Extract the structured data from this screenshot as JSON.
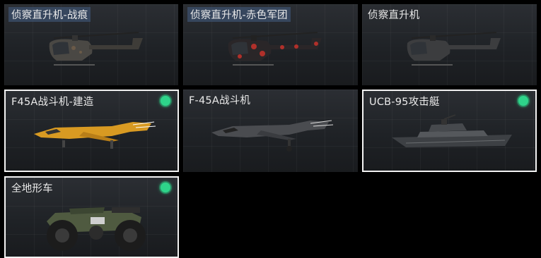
{
  "vehicles": [
    {
      "name": "侦察直升机-战痕"
    },
    {
      "name": "侦察直升机-赤色军团"
    },
    {
      "name": "侦察直升机"
    },
    {
      "name": "F45A战斗机-建造"
    },
    {
      "name": "F-45A战斗机"
    },
    {
      "name": "UCB-95攻击艇"
    },
    {
      "name": "全地形车"
    }
  ],
  "colors": {
    "equipped_dot": "#2ed48a",
    "selected_border": "#f2f2f2"
  },
  "icons": {
    "status": "green-dot-icon"
  }
}
